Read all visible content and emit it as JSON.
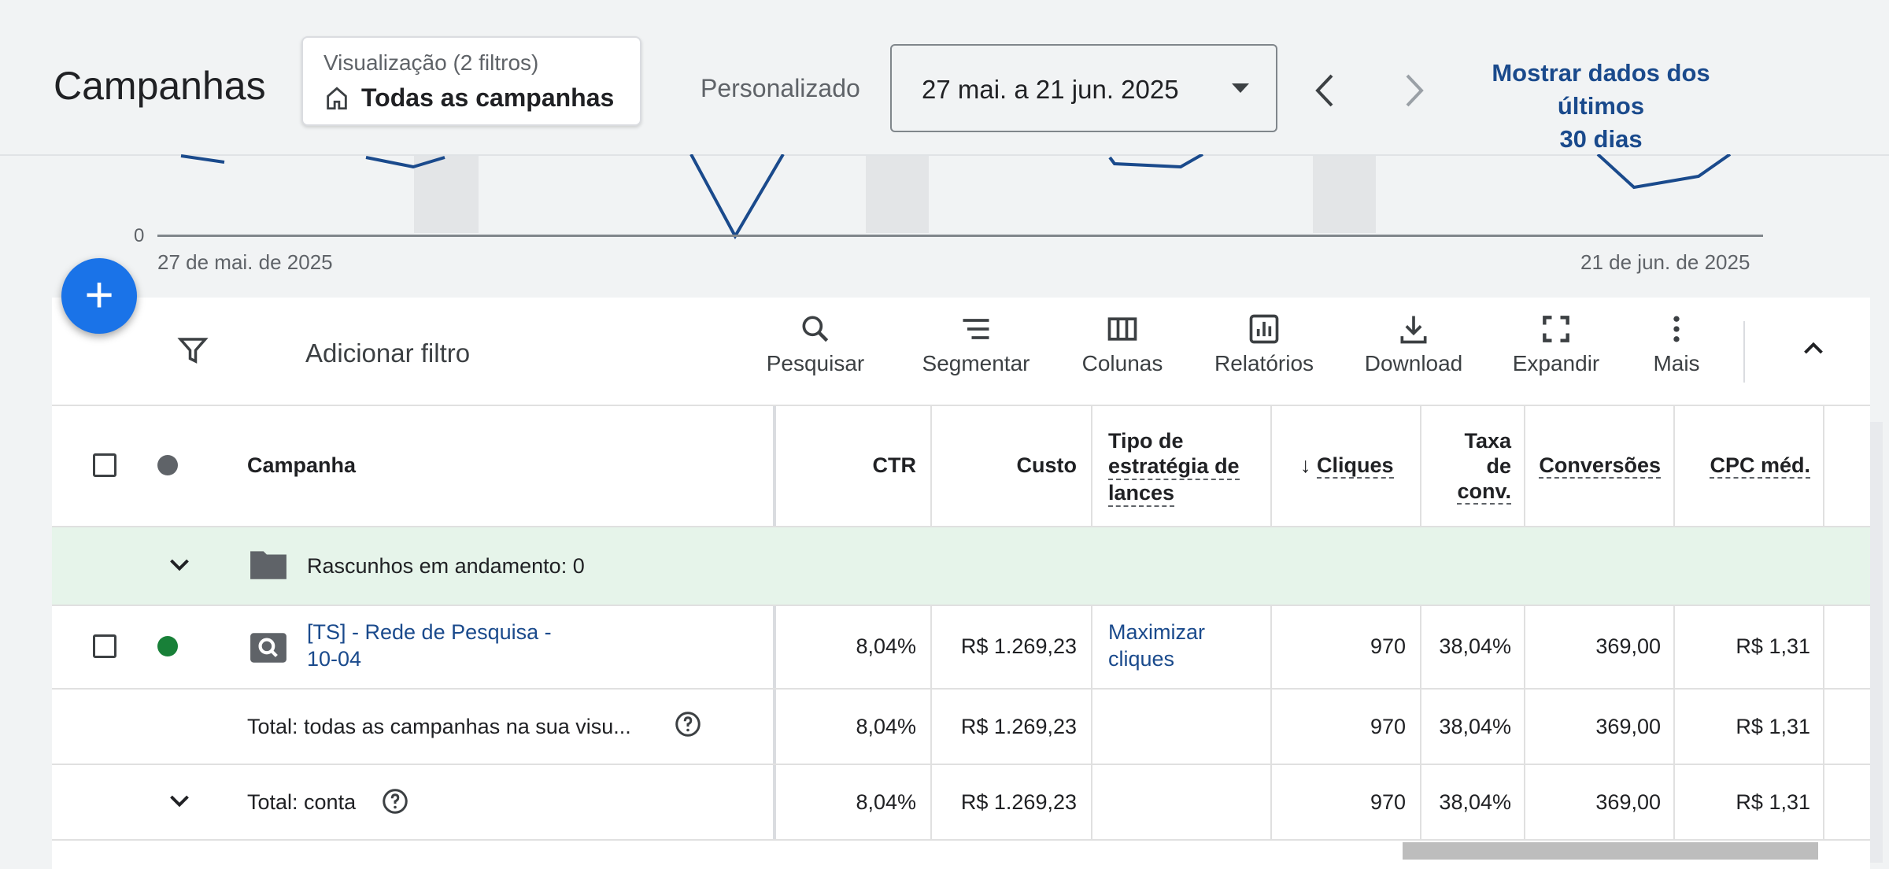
{
  "header": {
    "title": "Campanhas",
    "view": {
      "subtitle": "Visualização (2 filtros)",
      "name": "Todas as campanhas"
    },
    "period_label": "Personalizado",
    "date_range": "27 mai. a 21 jun. 2025",
    "show_last_line1": "Mostrar dados dos últimos",
    "show_last_line2": "30 dias"
  },
  "chart": {
    "zero_label": "0",
    "start_date": "27 de mai. de 2025",
    "end_date": "21 de jun. de 2025"
  },
  "toolbar": {
    "add_filter": "Adicionar filtro",
    "search": "Pesquisar",
    "segment": "Segmentar",
    "columns": "Colunas",
    "reports": "Relatórios",
    "download": "Download",
    "expand": "Expandir",
    "more": "Mais"
  },
  "table": {
    "headers": {
      "campaign": "Campanha",
      "ctr": "CTR",
      "cost": "Custo",
      "bid_l1": "Tipo de",
      "bid_l2": "estratégia de",
      "bid_l3": "lances",
      "clicks": "Cliques",
      "conv_rate_l1": "Taxa",
      "conv_rate_l2": "de",
      "conv_rate_l3": "conv.",
      "conversions": "Conversões",
      "cpc": "CPC méd."
    },
    "drafts": "Rascunhos em andamento: 0",
    "campaign_row": {
      "name_l1": "[TS] - Rede de Pesquisa -",
      "name_l2": "10-04",
      "ctr": "8,04%",
      "cost": "R$ 1.269,23",
      "bid_l1": "Maximizar",
      "bid_l2": "cliques",
      "clicks": "970",
      "conv_rate": "38,04%",
      "conversions": "369,00",
      "cpc": "R$ 1,31"
    },
    "total_view": {
      "label": "Total: todas as campanhas na sua visu...",
      "ctr": "8,04%",
      "cost": "R$ 1.269,23",
      "clicks": "970",
      "conv_rate": "38,04%",
      "conversions": "369,00",
      "cpc": "R$ 1,31"
    },
    "total_account": {
      "label": "Total: conta",
      "ctr": "8,04%",
      "cost": "R$ 1.269,23",
      "clicks": "970",
      "conv_rate": "38,04%",
      "conversions": "369,00",
      "cpc": "R$ 1,31"
    }
  },
  "colors": {
    "accent": "#1a73e8",
    "link": "#1a4a8c",
    "enabled": "#188038",
    "draft_bg": "#e6f4ea"
  }
}
